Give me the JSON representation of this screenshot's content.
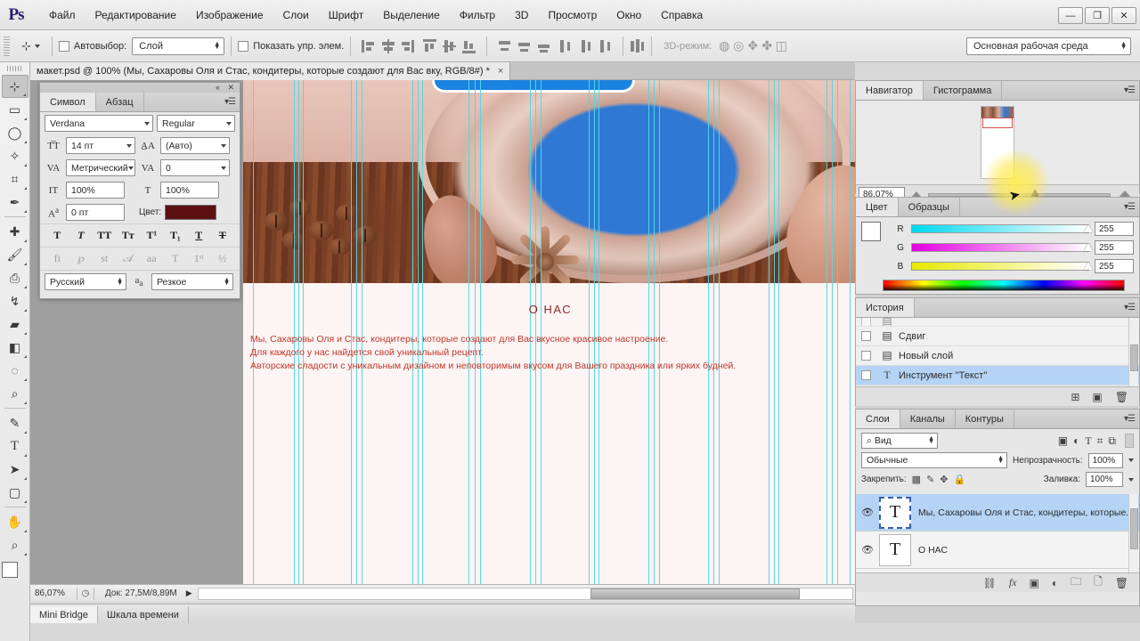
{
  "app": {
    "logo": "Ps"
  },
  "menubar": {
    "items": [
      "Файл",
      "Редактирование",
      "Изображение",
      "Слои",
      "Шрифт",
      "Выделение",
      "Фильтр",
      "3D",
      "Просмотр",
      "Окно",
      "Справка"
    ],
    "window_controls": {
      "minimize": "—",
      "restore": "❐",
      "close": "✕"
    }
  },
  "optionsbar": {
    "tool_icon": "move-tool-icon",
    "auto_select_label": "Автовыбор:",
    "auto_select_value": "Слой",
    "show_controls_label": "Показать упр. элем.",
    "mode_3d_label": "3D-режим:",
    "workspace": "Основная рабочая среда"
  },
  "toolbox": {
    "tools": [
      {
        "name": "move-tool",
        "glyph": "✛",
        "active": true
      },
      {
        "name": "marquee-tool",
        "glyph": "▭",
        "active": false
      },
      {
        "name": "lasso-tool",
        "glyph": "◯",
        "active": false
      },
      {
        "name": "quick-selection-tool",
        "glyph": "✧",
        "active": false
      },
      {
        "name": "crop-tool",
        "glyph": "⌗",
        "active": false
      },
      {
        "name": "eyedropper-tool",
        "glyph": "✎",
        "active": false
      },
      {
        "name": "healing-brush-tool",
        "glyph": "✚",
        "active": false
      },
      {
        "name": "brush-tool",
        "glyph": "🖌",
        "active": false
      },
      {
        "name": "clone-stamp-tool",
        "glyph": "⎙",
        "active": false
      },
      {
        "name": "history-brush-tool",
        "glyph": "↯",
        "active": false
      },
      {
        "name": "eraser-tool",
        "glyph": "▱",
        "active": false
      },
      {
        "name": "gradient-tool",
        "glyph": "◧",
        "active": false
      },
      {
        "name": "blur-tool",
        "glyph": "💧",
        "active": false
      },
      {
        "name": "dodge-tool",
        "glyph": "🔍",
        "active": false
      },
      {
        "name": "pen-tool",
        "glyph": "✒",
        "active": false
      },
      {
        "name": "type-tool",
        "glyph": "T",
        "active": false
      },
      {
        "name": "path-selection-tool",
        "glyph": "➤",
        "active": false
      },
      {
        "name": "rectangle-tool",
        "glyph": "▢",
        "active": false
      },
      {
        "name": "hand-tool",
        "glyph": "✋",
        "active": false
      },
      {
        "name": "zoom-tool",
        "glyph": "⌕",
        "active": false
      }
    ]
  },
  "document": {
    "tab_title": "макет.psd @ 100% (Мы, Сахаровы Оля и Стас, кондитеры, которые создают для Вас вку, RGB/8#) *",
    "close_glyph": "×"
  },
  "canvas": {
    "heading": "О НАС",
    "paragraph_lines": [
      "Мы, Сахаровы Оля и Стас, кондитеры, которые создают для Вас вкусное красивое настроение.",
      "Для каждого у нас найдется свой уникальный рецепт.",
      "Авторские сладости с уникальным дизайном и неповторимым вкусом для Вашего праздника или ярких будней."
    ],
    "guide_color": "#4fd8e8",
    "text_color": "#c0392b",
    "heading_color": "#8b2b2b"
  },
  "statusbar": {
    "zoom": "86,07%",
    "doc_size": "Док: 27,5M/8,89M",
    "arrow": "▶"
  },
  "bottom_tabs": [
    {
      "label": "Mini Bridge",
      "selected": true
    },
    {
      "label": "Шкала времени",
      "selected": false
    }
  ],
  "character_panel": {
    "tabs": [
      {
        "label": "Символ",
        "selected": true
      },
      {
        "label": "Абзац",
        "selected": false
      }
    ],
    "font_family": "Verdana",
    "font_style": "Regular",
    "font_size": "14 пт",
    "leading": "(Авто)",
    "kerning": "Метрический",
    "tracking": "0",
    "vertical_scale": "100%",
    "horizontal_scale": "100%",
    "baseline_shift": "0 пт",
    "color_label": "Цвет:",
    "color_value": "#5c1111",
    "style_buttons": [
      "T",
      "T",
      "TT",
      "Tт",
      "T¹",
      "T₁",
      "T",
      "T"
    ],
    "opentype_buttons": [
      "fi",
      "℘",
      "st",
      "𝒜",
      "aa",
      "T",
      "1ˢᵗ",
      "½"
    ],
    "language": "Русский",
    "antialias_label": "aa",
    "antialias": "Резкое"
  },
  "navigator_panel": {
    "tabs": [
      {
        "label": "Навигатор",
        "selected": true
      },
      {
        "label": "Гистограмма",
        "selected": false
      }
    ],
    "zoom_value": "86,07%"
  },
  "color_panel": {
    "tabs": [
      {
        "label": "Цвет",
        "selected": true
      },
      {
        "label": "Образцы",
        "selected": false
      }
    ],
    "channels": [
      {
        "label": "R",
        "value": "255"
      },
      {
        "label": "G",
        "value": "255"
      },
      {
        "label": "B",
        "value": "255"
      }
    ],
    "foreground": "#ffffff",
    "background": "#1c86f2"
  },
  "history_panel": {
    "tabs": [
      {
        "label": "История",
        "selected": true
      }
    ],
    "items": [
      {
        "label": "Сдвиг",
        "icon": "document-icon",
        "selected": false
      },
      {
        "label": "Новый слой",
        "icon": "document-icon",
        "selected": false
      },
      {
        "label": "Инструмент \"Текст\"",
        "icon": "type-icon",
        "selected": true
      }
    ],
    "footer_icons": [
      "new-document-icon",
      "snapshot-camera-icon",
      "delete-trash-icon"
    ]
  },
  "layers_panel": {
    "tabs": [
      {
        "label": "Слои",
        "selected": true
      },
      {
        "label": "Каналы",
        "selected": false
      },
      {
        "label": "Контуры",
        "selected": false
      }
    ],
    "filter_label": "Вид",
    "filter_icons": [
      "image-filter-icon",
      "adjustment-filter-icon",
      "type-filter-icon",
      "shape-filter-icon",
      "smartobject-filter-icon"
    ],
    "blend_mode": "Обычные",
    "opacity_label": "Непрозрачность:",
    "opacity_value": "100%",
    "lock_label": "Закрепить:",
    "lock_icons": [
      "lock-transparency-icon",
      "lock-image-icon",
      "lock-position-icon",
      "lock-all-icon"
    ],
    "fill_label": "Заливка:",
    "fill_value": "100%",
    "layers": [
      {
        "name": "Мы, Сахаровы Оля и Стас, кондитеры, которые...",
        "thumb": "T",
        "visible": true,
        "selected": true
      },
      {
        "name": "О НАС",
        "thumb": "T",
        "visible": true,
        "selected": false
      }
    ],
    "footer_icons": [
      "link-icon",
      "fx-icon",
      "mask-icon",
      "adjustment-icon",
      "group-folder-icon",
      "new-layer-icon",
      "delete-trash-icon"
    ]
  }
}
